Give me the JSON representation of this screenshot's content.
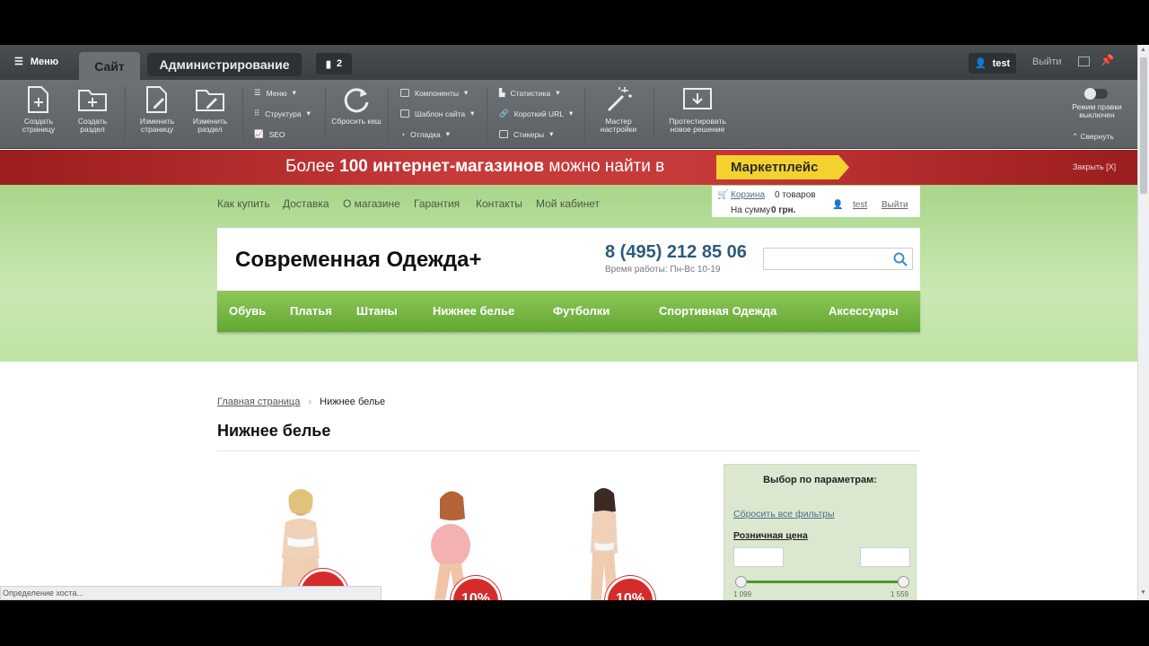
{
  "topbar": {
    "menu_label": "Меню",
    "tab_site": "Сайт",
    "tab_admin": "Администрирование",
    "notifications_count": "2",
    "user_name": "test",
    "logout_label": "Выйти"
  },
  "toolbar": {
    "create_page": "Создать страницу",
    "create_section": "Создать раздел",
    "edit_page": "Изменить страницу",
    "edit_section": "Изменить раздел",
    "menu": "Меню",
    "structure": "Структура",
    "seo": "SEO",
    "reset_cache": "Сбросить кеш",
    "components": "Компоненты",
    "site_template": "Шаблон сайта",
    "debug": "Отладка",
    "statistics": "Статистика",
    "short_url": "Короткий URL",
    "stickers": "Стикеры",
    "setup_wizard": "Мастер настройки",
    "test_solution": "Протестировать новое решение",
    "edit_mode": "Режим правки выключен",
    "collapse": "Свернуть"
  },
  "banner": {
    "text_pre": "Более ",
    "text_bold1": "100 интернет-магазинов",
    "text_post": " можно найти в",
    "button": "Маркетплейс",
    "close": "Закрыть [X]"
  },
  "header": {
    "links": [
      "Как купить",
      "Доставка",
      "О магазине",
      "Гарантия",
      "Контакты",
      "Мой кабинет"
    ],
    "cart_label": "Корзина",
    "cart_count": "0 товаров",
    "cart_sum_label": "На сумму",
    "cart_sum": "0 грн.",
    "user": "test",
    "logout": "Выйти",
    "logo": "Современная Одежда+",
    "phone": "8 (495) 212 85 06",
    "hours": "Время работы: Пн-Вс 10-19",
    "search_placeholder": ""
  },
  "categories": [
    "Обувь",
    "Платья",
    "Штаны",
    "Нижнее белье",
    "Футболки",
    "Спортивная Одежда",
    "Аксессуары"
  ],
  "breadcrumb": {
    "home": "Главная страница",
    "sep": "›",
    "current": "Нижнее белье"
  },
  "page_title": "Нижнее белье",
  "products": [
    {
      "badge": "10%"
    },
    {
      "badge": "10%"
    },
    {
      "badge": "10%"
    }
  ],
  "filter": {
    "title": "Выбор по параметрам:",
    "reset": "Сбросить все фильтры",
    "price_label": "Розничная цена",
    "min_placeholder": "",
    "max_placeholder": "",
    "range_min": "1 099",
    "range_max": "1 559"
  },
  "status_text": "Определение хоста...",
  "colors": {
    "brand_green": "#63a732",
    "banner_red": "#c73a3a",
    "marketplace_yellow": "#f4d22e"
  }
}
